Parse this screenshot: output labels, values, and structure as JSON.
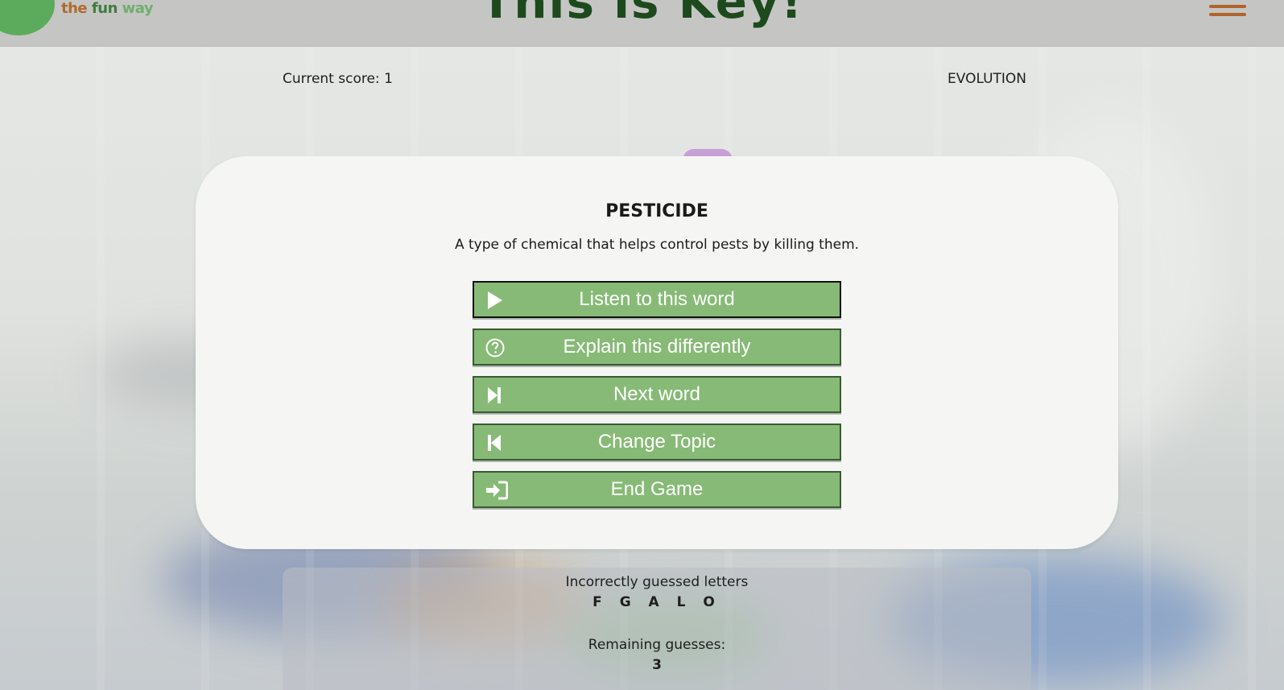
{
  "header": {
    "logo": {
      "the": "the",
      "fun": "fun",
      "way": "way"
    },
    "title": "This is Key!",
    "menu_icon": "hamburger-menu-icon",
    "colors": {
      "header_bg": "#c5c6c3",
      "title": "#1d4a1d",
      "menu": "#b0642a",
      "logo_green": "#5cab5c"
    }
  },
  "status": {
    "score_label": "Current score: 1",
    "topic": "EVOLUTION"
  },
  "card": {
    "word": "PESTICIDE",
    "definition": "A type of chemical that helps control pests by killing them.",
    "buttons": [
      {
        "label": "Listen to this word",
        "icon": "play-icon"
      },
      {
        "label": "Explain this differently",
        "icon": "question-circle-icon"
      },
      {
        "label": "Next word",
        "icon": "skip-forward-icon"
      },
      {
        "label": "Change Topic",
        "icon": "skip-back-icon"
      },
      {
        "label": "End Game",
        "icon": "sign-in-arrow-icon"
      }
    ],
    "colors": {
      "button_bg": "#87ba76",
      "button_border": "#3a5a34"
    }
  },
  "guesses": {
    "incorrect_label": "Incorrectly guessed letters",
    "incorrect_letters": "F G A L O",
    "remaining_label": "Remaining guesses:",
    "remaining_value": "3"
  }
}
